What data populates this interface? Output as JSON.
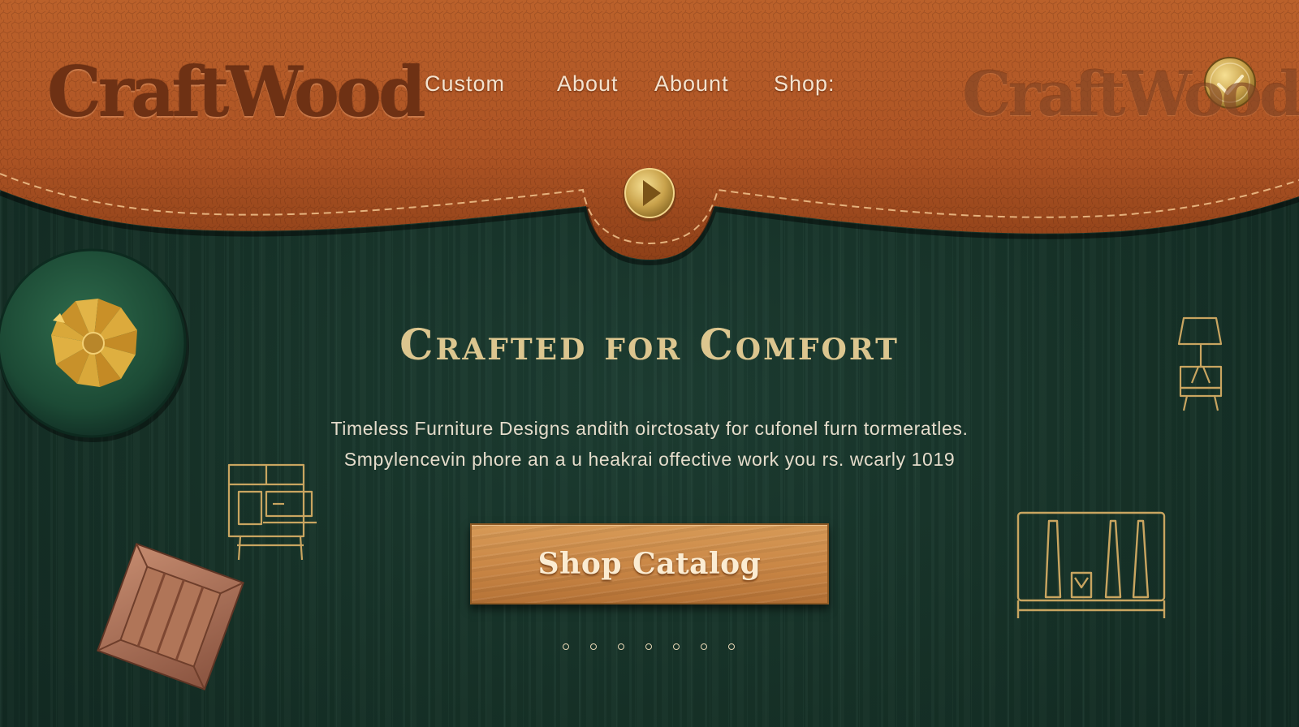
{
  "brand": {
    "logo_text": "CraftWood",
    "logo_text_faded": "CraftWood"
  },
  "nav": {
    "items": [
      {
        "label": "Custom"
      },
      {
        "label": "About"
      },
      {
        "label": "Abount"
      },
      {
        "label": "Shop:"
      }
    ]
  },
  "header_icons": {
    "play_button": "play-icon",
    "check_badge": "check-icon"
  },
  "decorations": {
    "left_medallion": "fan-flower-icon",
    "left_sketch": "dresser-sketch-icon",
    "left_box": "wooden-box-icon",
    "right_top_sketch": "lamp-table-sketch-icon",
    "right_bottom_sketch": "shelf-sketch-icon"
  },
  "hero": {
    "title": "Crafted for Comfort",
    "line_1": "Timeless Furniture Designs andith oirctosaty for cufonel furn tormeratles.",
    "line_2": "Smpylencevin phore an a u heakrai offective work you rs. wcarly 1019"
  },
  "cta": {
    "label": "Shop Catalog"
  },
  "carousel": {
    "count": 7,
    "active_index": 0
  },
  "colors": {
    "leather": "#b35a26",
    "background": "#173329",
    "gold": "#dcc68f",
    "button_wood": "#c98645"
  }
}
